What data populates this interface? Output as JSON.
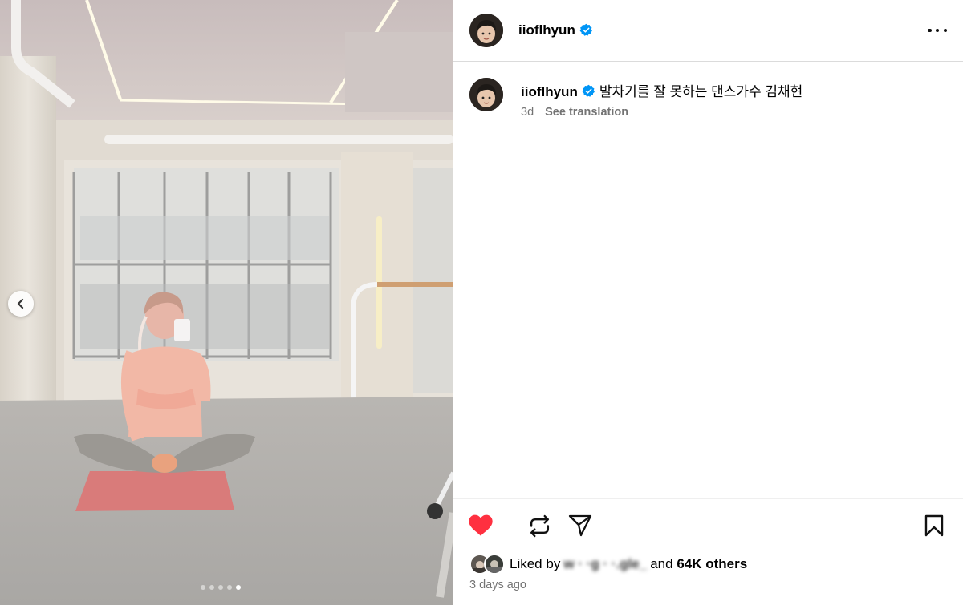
{
  "post": {
    "username": "iioflhyun",
    "verified": true,
    "caption": "발차기를 잘 못하는 댄스가수 김채현",
    "age_short": "3d",
    "see_translation_label": "See translation",
    "liked_by_prefix": "Liked by",
    "liked_by_name": "w  · ·g ·  ·.gle_",
    "liked_by_joiner": "and",
    "liked_by_others": "64K others",
    "timestamp": "3 days ago"
  },
  "media": {
    "slide_count": 5,
    "active_slide_index": 4
  },
  "icons": {
    "more": "more-horizontal-icon",
    "prev": "chevron-left-icon",
    "like": "heart-filled-icon",
    "repost": "repost-icon",
    "share": "send-icon",
    "save": "bookmark-icon",
    "verified": "verified-badge-icon"
  },
  "colors": {
    "like": "#ff3040",
    "verified": "#0095f6",
    "secondary_text": "#737373",
    "border": "#dbdbdb"
  }
}
